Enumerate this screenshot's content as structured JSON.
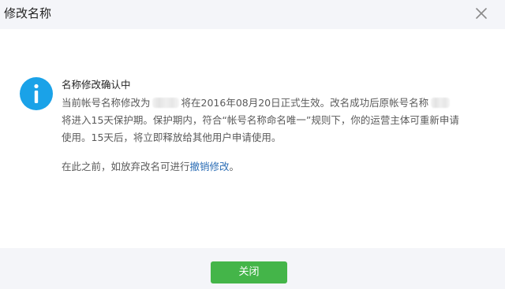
{
  "dialog": {
    "title": "修改名称",
    "close_icon": "close-x-icon"
  },
  "message": {
    "icon": "info-icon",
    "icon_color": "#1aa2e8",
    "title": "名称修改确认中",
    "line1_a": "当前帐号名称修改为",
    "line1_b": "将在2016年08月20日正式生效。改名成功后原帐号名称",
    "line2": "将进入15天保护期。保护期内，符合“帐号名称命名唯一”规则下，你的运营主体可重新申请",
    "line3": "使用。15天后，将立即释放给其他用户申请使用。",
    "note_prefix": "在此之前，如放弃改名可进行",
    "note_link": "撤销修改",
    "note_suffix": "。"
  },
  "footer": {
    "close_label": "关闭",
    "button_color": "#44b549"
  }
}
